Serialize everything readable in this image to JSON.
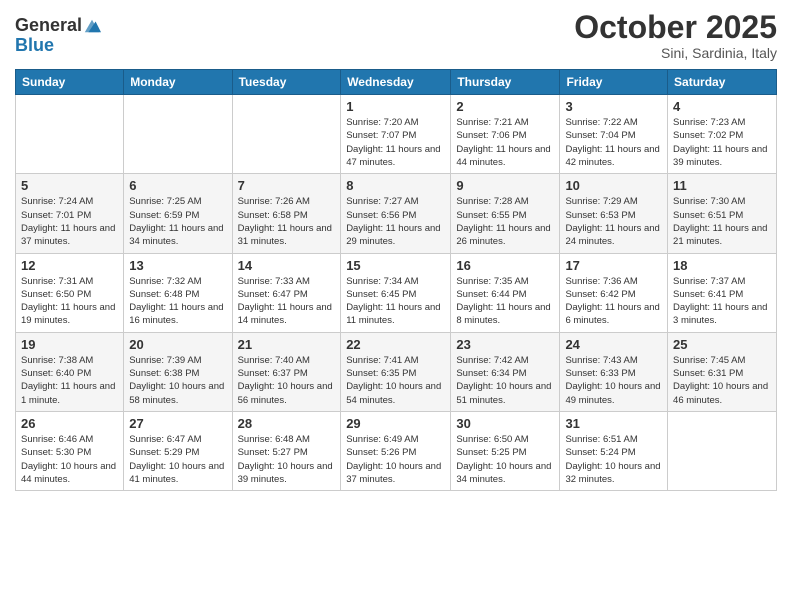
{
  "logo": {
    "general": "General",
    "blue": "Blue"
  },
  "title": "October 2025",
  "subtitle": "Sini, Sardinia, Italy",
  "days_header": [
    "Sunday",
    "Monday",
    "Tuesday",
    "Wednesday",
    "Thursday",
    "Friday",
    "Saturday"
  ],
  "weeks": [
    [
      {
        "num": "",
        "info": ""
      },
      {
        "num": "",
        "info": ""
      },
      {
        "num": "",
        "info": ""
      },
      {
        "num": "1",
        "info": "Sunrise: 7:20 AM\nSunset: 7:07 PM\nDaylight: 11 hours and 47 minutes."
      },
      {
        "num": "2",
        "info": "Sunrise: 7:21 AM\nSunset: 7:06 PM\nDaylight: 11 hours and 44 minutes."
      },
      {
        "num": "3",
        "info": "Sunrise: 7:22 AM\nSunset: 7:04 PM\nDaylight: 11 hours and 42 minutes."
      },
      {
        "num": "4",
        "info": "Sunrise: 7:23 AM\nSunset: 7:02 PM\nDaylight: 11 hours and 39 minutes."
      }
    ],
    [
      {
        "num": "5",
        "info": "Sunrise: 7:24 AM\nSunset: 7:01 PM\nDaylight: 11 hours and 37 minutes."
      },
      {
        "num": "6",
        "info": "Sunrise: 7:25 AM\nSunset: 6:59 PM\nDaylight: 11 hours and 34 minutes."
      },
      {
        "num": "7",
        "info": "Sunrise: 7:26 AM\nSunset: 6:58 PM\nDaylight: 11 hours and 31 minutes."
      },
      {
        "num": "8",
        "info": "Sunrise: 7:27 AM\nSunset: 6:56 PM\nDaylight: 11 hours and 29 minutes."
      },
      {
        "num": "9",
        "info": "Sunrise: 7:28 AM\nSunset: 6:55 PM\nDaylight: 11 hours and 26 minutes."
      },
      {
        "num": "10",
        "info": "Sunrise: 7:29 AM\nSunset: 6:53 PM\nDaylight: 11 hours and 24 minutes."
      },
      {
        "num": "11",
        "info": "Sunrise: 7:30 AM\nSunset: 6:51 PM\nDaylight: 11 hours and 21 minutes."
      }
    ],
    [
      {
        "num": "12",
        "info": "Sunrise: 7:31 AM\nSunset: 6:50 PM\nDaylight: 11 hours and 19 minutes."
      },
      {
        "num": "13",
        "info": "Sunrise: 7:32 AM\nSunset: 6:48 PM\nDaylight: 11 hours and 16 minutes."
      },
      {
        "num": "14",
        "info": "Sunrise: 7:33 AM\nSunset: 6:47 PM\nDaylight: 11 hours and 14 minutes."
      },
      {
        "num": "15",
        "info": "Sunrise: 7:34 AM\nSunset: 6:45 PM\nDaylight: 11 hours and 11 minutes."
      },
      {
        "num": "16",
        "info": "Sunrise: 7:35 AM\nSunset: 6:44 PM\nDaylight: 11 hours and 8 minutes."
      },
      {
        "num": "17",
        "info": "Sunrise: 7:36 AM\nSunset: 6:42 PM\nDaylight: 11 hours and 6 minutes."
      },
      {
        "num": "18",
        "info": "Sunrise: 7:37 AM\nSunset: 6:41 PM\nDaylight: 11 hours and 3 minutes."
      }
    ],
    [
      {
        "num": "19",
        "info": "Sunrise: 7:38 AM\nSunset: 6:40 PM\nDaylight: 11 hours and 1 minute."
      },
      {
        "num": "20",
        "info": "Sunrise: 7:39 AM\nSunset: 6:38 PM\nDaylight: 10 hours and 58 minutes."
      },
      {
        "num": "21",
        "info": "Sunrise: 7:40 AM\nSunset: 6:37 PM\nDaylight: 10 hours and 56 minutes."
      },
      {
        "num": "22",
        "info": "Sunrise: 7:41 AM\nSunset: 6:35 PM\nDaylight: 10 hours and 54 minutes."
      },
      {
        "num": "23",
        "info": "Sunrise: 7:42 AM\nSunset: 6:34 PM\nDaylight: 10 hours and 51 minutes."
      },
      {
        "num": "24",
        "info": "Sunrise: 7:43 AM\nSunset: 6:33 PM\nDaylight: 10 hours and 49 minutes."
      },
      {
        "num": "25",
        "info": "Sunrise: 7:45 AM\nSunset: 6:31 PM\nDaylight: 10 hours and 46 minutes."
      }
    ],
    [
      {
        "num": "26",
        "info": "Sunrise: 6:46 AM\nSunset: 5:30 PM\nDaylight: 10 hours and 44 minutes."
      },
      {
        "num": "27",
        "info": "Sunrise: 6:47 AM\nSunset: 5:29 PM\nDaylight: 10 hours and 41 minutes."
      },
      {
        "num": "28",
        "info": "Sunrise: 6:48 AM\nSunset: 5:27 PM\nDaylight: 10 hours and 39 minutes."
      },
      {
        "num": "29",
        "info": "Sunrise: 6:49 AM\nSunset: 5:26 PM\nDaylight: 10 hours and 37 minutes."
      },
      {
        "num": "30",
        "info": "Sunrise: 6:50 AM\nSunset: 5:25 PM\nDaylight: 10 hours and 34 minutes."
      },
      {
        "num": "31",
        "info": "Sunrise: 6:51 AM\nSunset: 5:24 PM\nDaylight: 10 hours and 32 minutes."
      },
      {
        "num": "",
        "info": ""
      }
    ]
  ]
}
